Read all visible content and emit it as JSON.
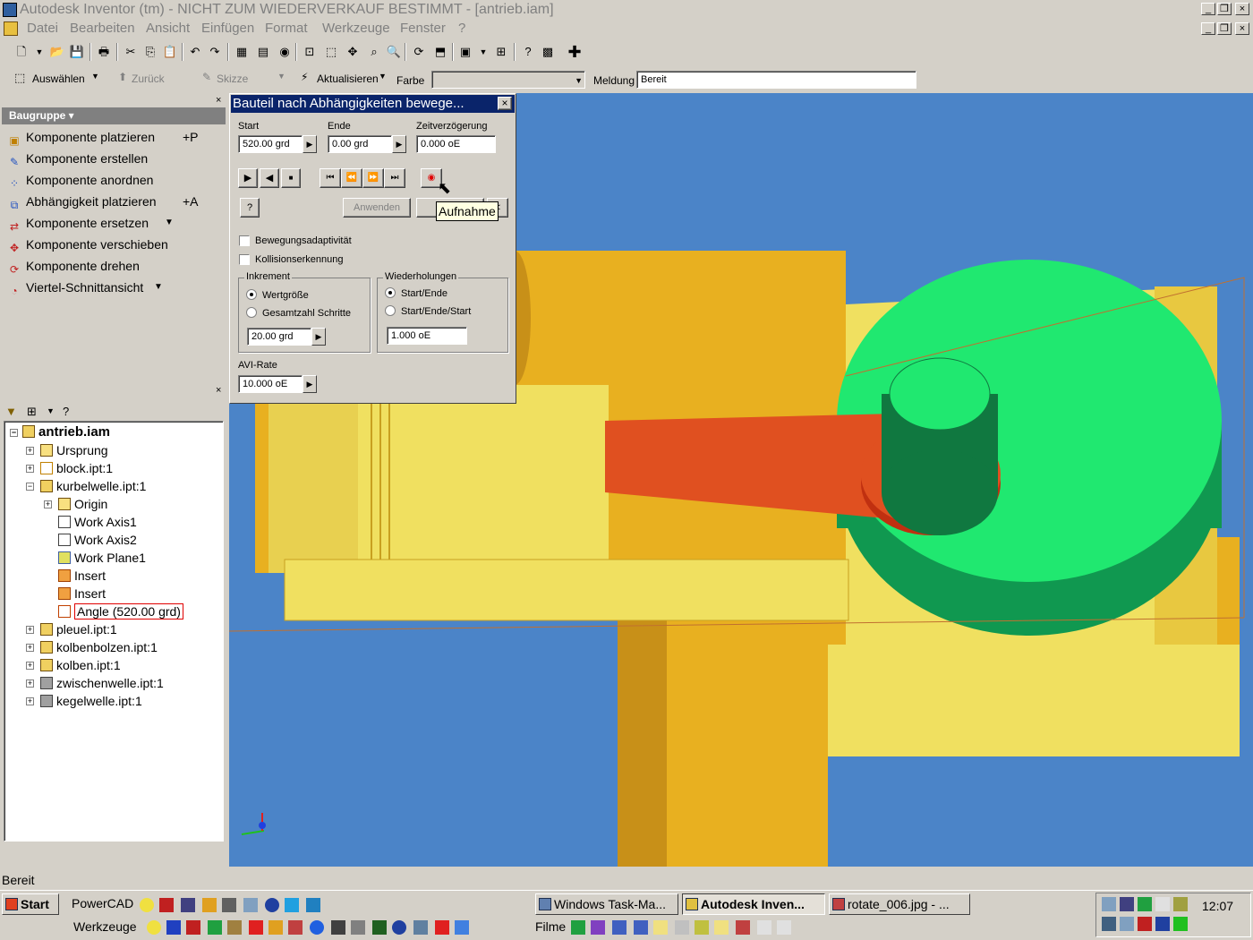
{
  "window": {
    "title": "Autodesk Inventor (tm) - NICHT ZUM WIEDERVERKAUF BESTIMMT - [antrieb.iam]"
  },
  "menu": [
    "Datei",
    "Bearbeiten",
    "Ansicht",
    "Einfügen",
    "Format",
    "Werkzeuge",
    "Fenster",
    "?"
  ],
  "toolbar2": {
    "select_label": "Auswählen",
    "back_label": "Zurück",
    "sketch_label": "Skizze",
    "update_label": "Aktualisieren",
    "color_label": "Farbe",
    "message_label": "Meldung",
    "message_value": "Bereit"
  },
  "panel": {
    "header": "Baugruppe",
    "commands": [
      {
        "label": "Komponente platzieren",
        "shortcut": "+P"
      },
      {
        "label": "Komponente erstellen",
        "shortcut": ""
      },
      {
        "label": "Komponente anordnen",
        "shortcut": ""
      },
      {
        "label": "Abhängigkeit platzieren",
        "shortcut": "+A"
      },
      {
        "label": "Komponente ersetzen",
        "shortcut": ""
      },
      {
        "label": "Komponente verschieben",
        "shortcut": ""
      },
      {
        "label": "Komponente drehen",
        "shortcut": ""
      },
      {
        "label": "Viertel-Schnittansicht",
        "shortcut": ""
      }
    ]
  },
  "tree": {
    "root": "antrieb.iam",
    "nodes": [
      "Ursprung",
      "block.ipt:1",
      "kurbelwelle.ipt:1",
      "Origin",
      "Work Axis1",
      "Work Axis2",
      "Work Plane1",
      "Insert",
      "Insert",
      "Angle (520.00 grd)",
      "pleuel.ipt:1",
      "kolbenbolzen.ipt:1",
      "kolben.ipt:1",
      "zwischenwelle.ipt:1",
      "kegelwelle.ipt:1"
    ]
  },
  "dialog": {
    "title": "Bauteil nach Abhängigkeiten bewege...",
    "start_label": "Start",
    "start_value": "520.00 grd",
    "end_label": "Ende",
    "end_value": "0.00 grd",
    "delay_label": "Zeitverzögerung",
    "delay_value": "0.000 oE",
    "apply_label": "Anwenden",
    "cancel_label": "Ab",
    "motion_adaptivity": "Bewegungsadaptivität",
    "collision": "Kollisionserkennung",
    "increment_group": "Inkrement",
    "increment_opt1": "Wertgröße",
    "increment_opt2": "Gesamtzahl Schritte",
    "increment_value": "20.00 grd",
    "repeat_group": "Wiederholungen",
    "repeat_opt1": "Start/Ende",
    "repeat_opt2": "Start/Ende/Start",
    "repeat_value": "1.000 oE",
    "avi_label": "AVI-Rate",
    "avi_value": "10.000 oE"
  },
  "tooltip": "Aufnahme",
  "status": "Bereit",
  "taskbar": {
    "start": "Start",
    "powercad": "PowerCAD",
    "werkzeuge": "Werkzeuge",
    "filme": "Filme",
    "tasks": [
      "Windows Task-Ma...",
      "Autodesk Inven...",
      "rotate_006.jpg - ..."
    ],
    "clock": "12:07"
  },
  "colors": {
    "viewport_bg": "#4b84c8",
    "part_yellow": "#f0e060",
    "part_orange": "#e8b020",
    "crank_green": "#20e870",
    "rod_red": "#e05020",
    "title_active": "#0a246a"
  }
}
